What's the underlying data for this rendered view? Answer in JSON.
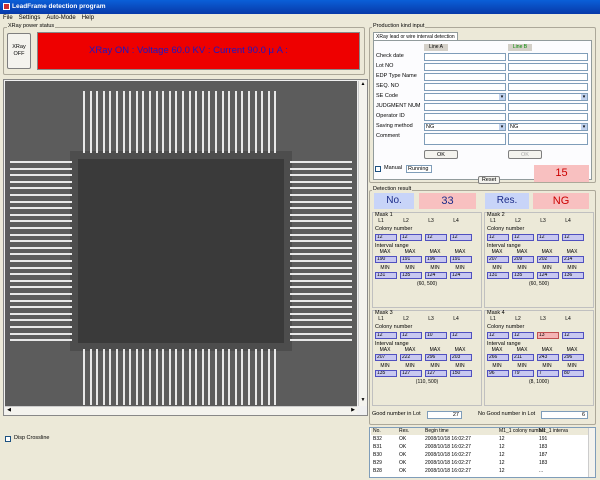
{
  "window": {
    "title": "LeadFrame detection program"
  },
  "menu": [
    "File",
    "Settings",
    "Auto-Mode",
    "Help"
  ],
  "xray": {
    "group_label": "XRay power status",
    "button": "XRay\nOFF",
    "status": "XRay ON : Voltage 60.0 KV : Current 90.0  μ A :"
  },
  "crossline": {
    "label": "Disp Crossline"
  },
  "production": {
    "group_label": "Production kind input",
    "tab": "XRay lead or wire interval detection",
    "line_a": "Line A",
    "line_b": "Line B",
    "fields": [
      "Check date",
      "Lot NO",
      "EDP Type Name",
      "SEQ. NO",
      "SE Code",
      "JUDGMENT NUM",
      "Operator ID",
      "Saving method",
      "Comment"
    ],
    "saving_a": "NG",
    "saving_b": "NG",
    "ok_label": "OK",
    "manual": "Manual",
    "running": "Running",
    "reset": "Reset",
    "counter": "15"
  },
  "detection": {
    "group_label": "Detection result",
    "no_label": "No.",
    "no_value": "33",
    "res_label": "Res.",
    "res_value": "NG",
    "masks": [
      {
        "title": "Mask 1",
        "colony_label": "Colony number",
        "colony": [
          "12",
          "12",
          "12",
          "12"
        ],
        "range_label": "Interval range",
        "max": [
          "190",
          "191",
          "196",
          "191"
        ],
        "min": [
          "131",
          "135",
          "124",
          "124"
        ],
        "center": "(60, 500)"
      },
      {
        "title": "Mask 2",
        "colony_label": "Colony number",
        "colony": [
          "12",
          "12",
          "12",
          "12"
        ],
        "range_label": "Interval range",
        "max": [
          "207",
          "209",
          "202",
          "214"
        ],
        "min": [
          "131",
          "135",
          "124",
          "136"
        ],
        "center": "(60, 500)"
      },
      {
        "title": "Mask 3",
        "colony_label": "Colony number",
        "colony": [
          "12",
          "12",
          "10",
          "12"
        ],
        "range_label": "Interval range",
        "max": [
          "207",
          "222",
          "296",
          "203"
        ],
        "min": [
          "135",
          "127",
          "127",
          "150"
        ],
        "center": "(110, 500)"
      },
      {
        "title": "Mask 4",
        "colony_label": "Colony number",
        "colony": [
          "12",
          "12",
          "13",
          "12"
        ],
        "range_label": "Interval range",
        "max": [
          "266",
          "211",
          "243",
          "296"
        ],
        "min": [
          "96",
          "79",
          "7",
          "80"
        ],
        "center": "(8, 1000)"
      }
    ],
    "headers": [
      "L1",
      "L2",
      "L3",
      "L4"
    ],
    "max_label": "MAX",
    "min_label": "MIN",
    "good_label": "Good number in Lot",
    "good_value": "27",
    "nogood_label": "No Good number in Lot",
    "nogood_value": "6"
  },
  "table": {
    "columns": [
      "No.",
      "Res.",
      "Begin time",
      "M1_1 colony number",
      "M1_1 interva"
    ],
    "rows": [
      [
        "B32",
        "OK",
        "2008/10/18 16:02:27",
        "12",
        "191"
      ],
      [
        "B31",
        "OK",
        "2008/10/18 16:02:27",
        "12",
        "183"
      ],
      [
        "B30",
        "OK",
        "2008/10/18 16:02:27",
        "12",
        "187"
      ],
      [
        "B29",
        "OK",
        "2008/10/18 16:02:27",
        "12",
        "183"
      ],
      [
        "B28",
        "OK",
        "2008/10/18 16:02:27",
        "12",
        "..."
      ]
    ]
  }
}
